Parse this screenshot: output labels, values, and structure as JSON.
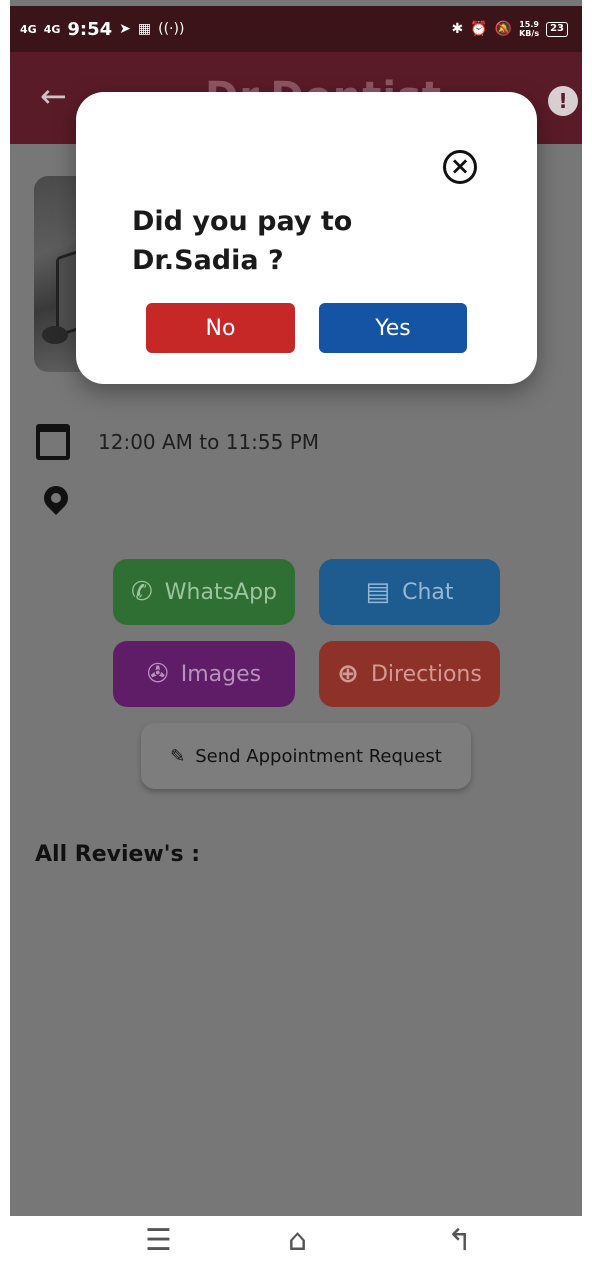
{
  "status_bar": {
    "network1": "4G",
    "network2": "4G",
    "time": "9:54",
    "speed_value": "15.9",
    "speed_unit": "KB/s",
    "battery": "23"
  },
  "app_bar": {
    "back_icon": "arrow-left-icon",
    "title": "Dr.Dentist",
    "report_icon": "alert-icon"
  },
  "schedule": {
    "time_text": "12:00 AM   to  11:55 PM"
  },
  "actions": {
    "whatsapp_label": "WhatsApp",
    "chat_label": "Chat",
    "images_label": "Images",
    "directions_label": "Directions",
    "appointment_label": "Send Appointment Request"
  },
  "reviews": {
    "title": "All Review's :"
  },
  "dialog": {
    "question": "Did you pay to Dr.Sadia ?",
    "no_label": "No",
    "yes_label": "Yes"
  },
  "colors": {
    "app_bar": "#5a1b28",
    "no_button": "#c62828",
    "yes_button": "#1553a5",
    "whatsapp": "#2f6f33",
    "chat": "#1e5b8e",
    "images": "#5e1d66",
    "directions": "#8e3128",
    "overlay": "#777777"
  }
}
